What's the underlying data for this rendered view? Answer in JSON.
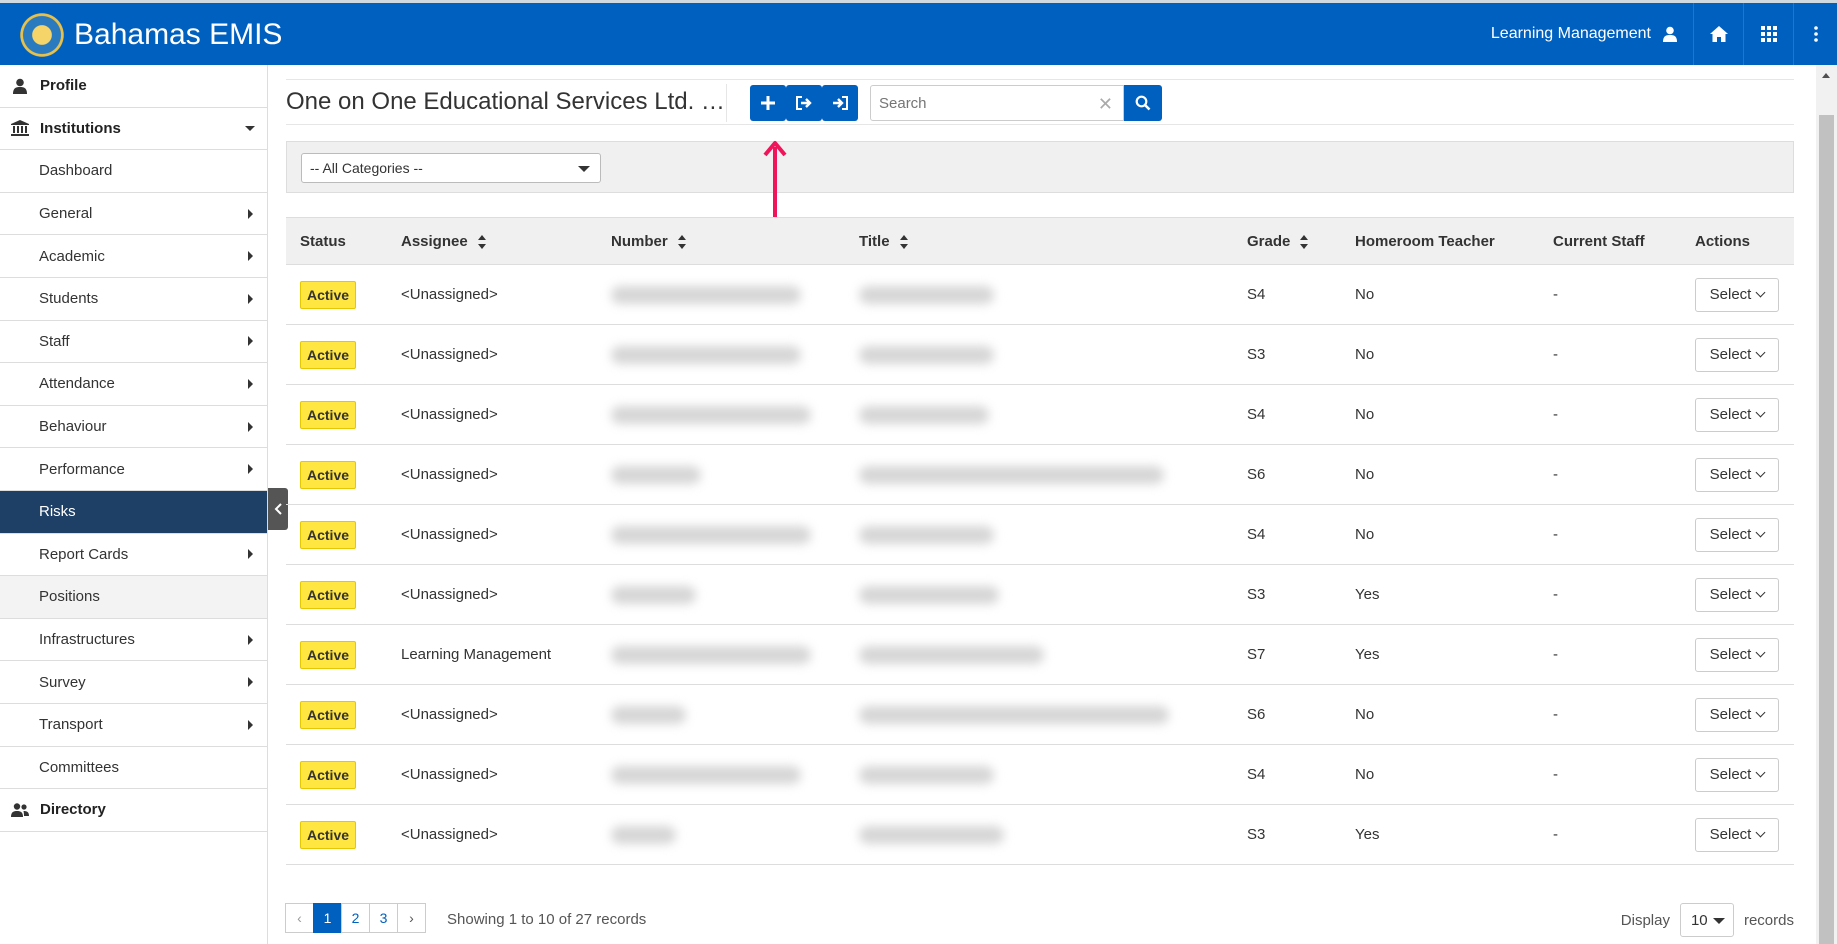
{
  "brand": {
    "name": "Bahamas EMIS"
  },
  "topbar": {
    "user_label": "Learning Management"
  },
  "sidebar": {
    "items": [
      {
        "label": "Profile",
        "name": "sidebar-item-profile",
        "type": "top",
        "icon": "person-icon"
      },
      {
        "label": "Institutions",
        "name": "sidebar-item-institutions",
        "type": "top",
        "icon": "institution-icon",
        "expanded": true
      },
      {
        "label": "Dashboard",
        "name": "sidebar-item-dashboard"
      },
      {
        "label": "General",
        "name": "sidebar-item-general",
        "submenu": true
      },
      {
        "label": "Academic",
        "name": "sidebar-item-academic",
        "submenu": true
      },
      {
        "label": "Students",
        "name": "sidebar-item-students",
        "submenu": true
      },
      {
        "label": "Staff",
        "name": "sidebar-item-staff",
        "submenu": true
      },
      {
        "label": "Attendance",
        "name": "sidebar-item-attendance",
        "submenu": true
      },
      {
        "label": "Behaviour",
        "name": "sidebar-item-behaviour",
        "submenu": true
      },
      {
        "label": "Performance",
        "name": "sidebar-item-performance",
        "submenu": true
      },
      {
        "label": "Risks",
        "name": "sidebar-item-risks",
        "active": true
      },
      {
        "label": "Report Cards",
        "name": "sidebar-item-report-cards",
        "submenu": true
      },
      {
        "label": "Positions",
        "name": "sidebar-item-positions",
        "light": true
      },
      {
        "label": "Infrastructures",
        "name": "sidebar-item-infrastructures",
        "submenu": true
      },
      {
        "label": "Survey",
        "name": "sidebar-item-survey",
        "submenu": true
      },
      {
        "label": "Transport",
        "name": "sidebar-item-transport",
        "submenu": true
      },
      {
        "label": "Committees",
        "name": "sidebar-item-committees"
      },
      {
        "label": "Directory",
        "name": "sidebar-item-directory",
        "type": "top",
        "icon": "users-icon"
      }
    ]
  },
  "page": {
    "title": "One on One Educational Services Ltd. - Risks"
  },
  "search": {
    "placeholder": "Search",
    "value": ""
  },
  "filter": {
    "category_selected": "-- All Categories --"
  },
  "table": {
    "headers": {
      "status": "Status",
      "assignee": "Assignee",
      "number": "Number",
      "title": "Title",
      "grade": "Grade",
      "homeroom": "Homeroom Teacher",
      "current_staff": "Current Staff",
      "actions": "Actions"
    },
    "rows": [
      {
        "status": "Active",
        "assignee": "<Unassigned>",
        "grade": "S4",
        "homeroom": "No",
        "current_staff": "-",
        "action": "Select"
      },
      {
        "status": "Active",
        "assignee": "<Unassigned>",
        "grade": "S3",
        "homeroom": "No",
        "current_staff": "-",
        "action": "Select"
      },
      {
        "status": "Active",
        "assignee": "<Unassigned>",
        "grade": "S4",
        "homeroom": "No",
        "current_staff": "-",
        "action": "Select"
      },
      {
        "status": "Active",
        "assignee": "<Unassigned>",
        "grade": "S6",
        "homeroom": "No",
        "current_staff": "-",
        "action": "Select"
      },
      {
        "status": "Active",
        "assignee": "<Unassigned>",
        "grade": "S4",
        "homeroom": "No",
        "current_staff": "-",
        "action": "Select"
      },
      {
        "status": "Active",
        "assignee": "<Unassigned>",
        "grade": "S3",
        "homeroom": "Yes",
        "current_staff": "-",
        "action": "Select"
      },
      {
        "status": "Active",
        "assignee": "Learning Management",
        "grade": "S7",
        "homeroom": "Yes",
        "current_staff": "-",
        "action": "Select"
      },
      {
        "status": "Active",
        "assignee": "<Unassigned>",
        "grade": "S6",
        "homeroom": "No",
        "current_staff": "-",
        "action": "Select"
      },
      {
        "status": "Active",
        "assignee": "<Unassigned>",
        "grade": "S4",
        "homeroom": "No",
        "current_staff": "-",
        "action": "Select"
      },
      {
        "status": "Active",
        "assignee": "<Unassigned>",
        "grade": "S3",
        "homeroom": "Yes",
        "current_staff": "-",
        "action": "Select"
      }
    ]
  },
  "pagination": {
    "prev": "‹",
    "pages": [
      "1",
      "2",
      "3"
    ],
    "current": "1",
    "next": "›",
    "showing": "Showing 1 to 10 of 27 records"
  },
  "display": {
    "label": "Display",
    "value": "10",
    "suffix": "records"
  },
  "colors": {
    "primary": "#0060c0",
    "sidebar_active": "#1e3f66",
    "badge": "#ffe640",
    "arrow": "#f0145a"
  }
}
